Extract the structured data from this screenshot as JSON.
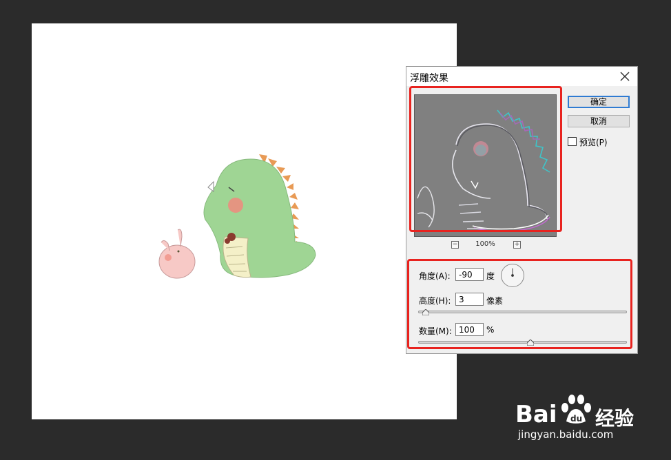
{
  "dialog": {
    "title": "浮雕效果",
    "ok_label": "确定",
    "cancel_label": "取消",
    "preview_label": "预览(P)",
    "preview_checked": false,
    "zoom": "100%",
    "angle": {
      "label": "角度(A):",
      "value": "-90",
      "unit": "度"
    },
    "height": {
      "label": "高度(H):",
      "value": "3",
      "unit": "像素",
      "slider_fraction": 0.02
    },
    "amount": {
      "label": "数量(M):",
      "value": "100",
      "unit": "%",
      "slider_fraction": 0.54
    }
  },
  "colors": {
    "highlight": "#e8231f",
    "dino": "#9fd594",
    "spikes": "#e89a55",
    "blush": "#f08a7e"
  },
  "icons": {
    "close": "close-icon",
    "zoom_out": "zoom-out-icon",
    "zoom_in": "zoom-in-icon",
    "angle_dial": "angle-dial-icon"
  },
  "watermark": {
    "brand_left": "Bai",
    "brand_right": "经验",
    "url": "jingyan.baidu.com"
  }
}
